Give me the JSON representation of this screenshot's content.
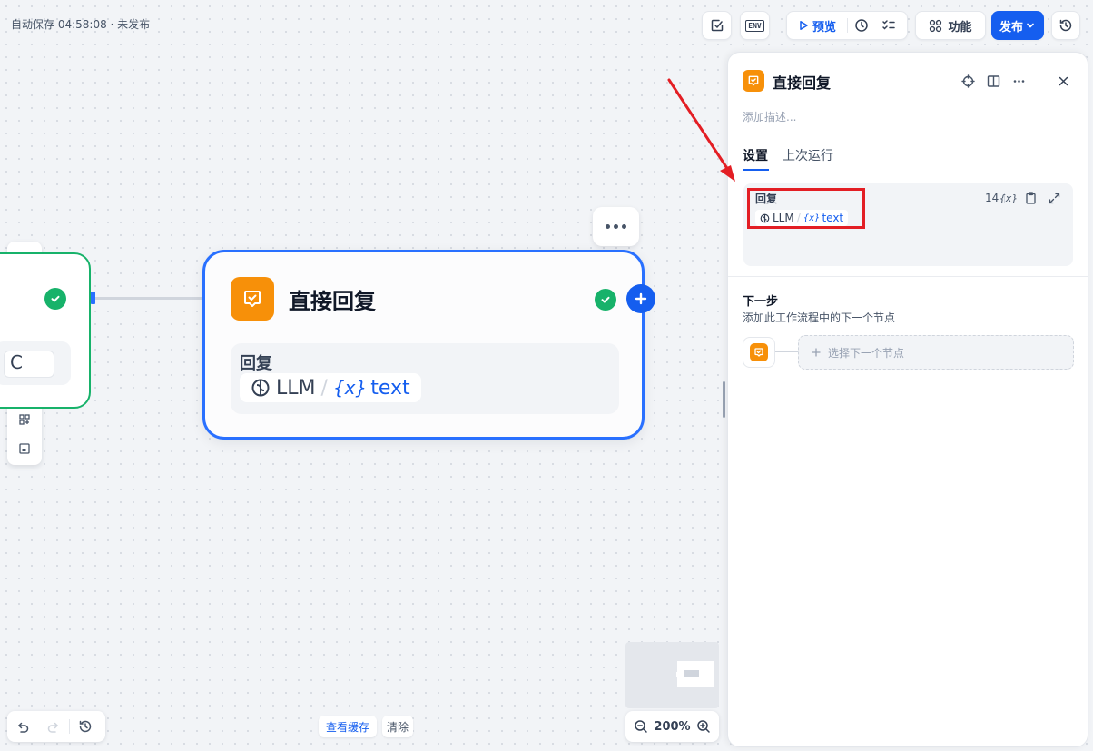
{
  "status": {
    "text": "自动保存 04:58:08 · 未发布"
  },
  "toolbar": {
    "env_label": "ENV",
    "preview_label": "预览",
    "features_label": "功能",
    "publish_label": "发布"
  },
  "canvas": {
    "node": {
      "title": "直接回复",
      "body_label": "回复",
      "var_source": "LLM",
      "var_separator": "/",
      "var_name": "text"
    },
    "left_node": {
      "chip_text": "C"
    }
  },
  "bottom": {
    "view_cache_label": "查看缓存",
    "clear_label": "清除",
    "zoom": "200%"
  },
  "panel": {
    "title": "直接回复",
    "description_placeholder": "添加描述...",
    "tabs": [
      {
        "label": "设置",
        "active": true
      },
      {
        "label": "上次运行",
        "active": false
      }
    ],
    "reply": {
      "label": "回复",
      "char_count": "14",
      "var_source": "LLM",
      "var_separator": "/",
      "var_name": "text",
      "var_button": "{x}"
    },
    "next_step": {
      "title": "下一步",
      "description": "添加此工作流程中的下一个节点",
      "select_label": "选择下一个节点"
    }
  },
  "colors": {
    "accent": "#155eef",
    "node_border": "#2970ff",
    "node_icon": "#f79009",
    "success": "#17b26a",
    "annotation_red": "#e31e24"
  }
}
